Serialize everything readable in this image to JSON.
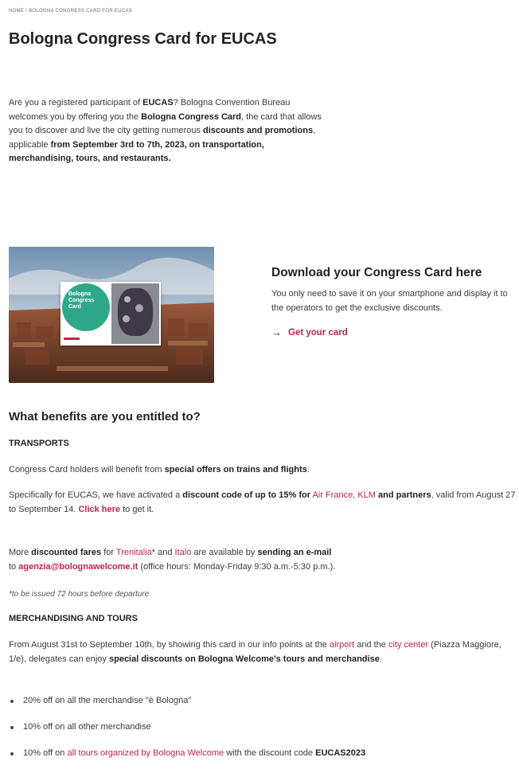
{
  "breadcrumb": {
    "text": "HOME / BOLOGNA CONGRESS CARD FOR EUCAS"
  },
  "page_title": "Bologna Congress Card for EUCAS",
  "intro": {
    "t1": "Are you a registered participant of ",
    "b1": "EUCAS",
    "t2": "? Bologna Convention Bureau welcomes you by offering you the ",
    "b2": "Bologna Congress Card",
    "t3": ", the card that allows you to discover and live the city getting numerous ",
    "b3": "discounts and promotions",
    "t4": ", applicable ",
    "b4": "from September 3rd to 7th, 2023, on transportation, merchandising, tours, and restaurants."
  },
  "hero_card": {
    "line1": "Bologna",
    "line2": "Congress",
    "line3": "Card"
  },
  "download": {
    "heading": "Download your Congress Card here",
    "text": "You only need to save it on your smartphone and display it to the operators to get the exclusive discounts.",
    "link_arrow": "→",
    "link_label": "Get your card"
  },
  "benefits_heading": "What benefits are you entitled to?",
  "transports": {
    "heading": "TRANSPORTS",
    "p1_t1": "Congress Card holders will benefit from ",
    "p1_b1": "special offers on trains and flights",
    "p1_t2": ".",
    "p2_t1": "Specifically for EUCAS, we have activated a ",
    "p2_b1": "discount code of up to 15% for",
    "p2_sp1": " ",
    "p2_l1": "Air France",
    "p2_t2": ", ",
    "p2_l2": "KLM",
    "p2_b2": " and partners",
    "p2_t3": ", valid from August 27 to September 14. ",
    "p2_l3": "Click here",
    "p2_t4": " to get it.",
    "p3_t1": "More ",
    "p3_b1": "discounted fares",
    "p3_t2": " for ",
    "p3_l1": "Trenitalia",
    "p3_t3": "* and ",
    "p3_l2": "Italo",
    "p3_t4": " are available by ",
    "p3_b2": "sending an e-mail",
    "p3_t5": " to ",
    "p3_l3": "agenzia@bolognawelcome.it",
    "p3_t6": " (office hours: Monday-Friday 9:30 a.m.-5:30 p.m.).",
    "note": "*to be issued 72 hours before departure"
  },
  "merch": {
    "heading": "MERCHANDISING AND TOURS",
    "p_t1": "From August 31st to September 10th, by showing this card in our info points at the ",
    "p_l1": "airport",
    "p_t2": " and the ",
    "p_l2": "city center",
    "p_t3": " (Piazza Maggiore, 1/e), delegates can enjoy ",
    "p_b1": "special discounts on Bologna Welcome's tours and merchandise",
    "p_t4": ".",
    "bullet1": "20% off on all the merchandise \"è Bologna\"",
    "bullet2": "10% off on all other merchandise",
    "bullet3_t1": "10% off on ",
    "bullet3_l1": "all tours organized by Bologna Welcome",
    "bullet3_t2": " with the discount code ",
    "bullet3_b1": "EUCAS2023"
  },
  "colors": {
    "accent": "#c0244d",
    "card_green": "#2fa88a"
  }
}
